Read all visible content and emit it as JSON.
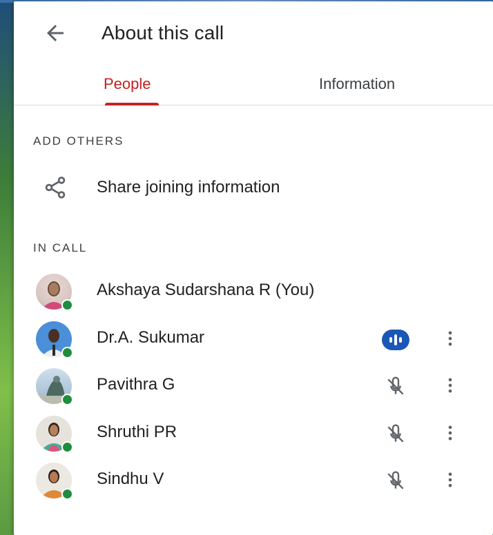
{
  "header": {
    "title": "About this call",
    "back_icon": "arrow-left-icon"
  },
  "tabs": [
    {
      "label": "People",
      "active": true
    },
    {
      "label": "Information",
      "active": false
    }
  ],
  "add_others": {
    "section_label": "ADD OTHERS",
    "share_label": "Share joining information",
    "share_icon": "share-icon"
  },
  "in_call": {
    "section_label": "IN CALL",
    "people": [
      {
        "name": "Akshaya Sudarshana R (You)",
        "status": "none",
        "online": true
      },
      {
        "name": "Dr.A. Sukumar",
        "status": "speaking",
        "online": true
      },
      {
        "name": "Pavithra G",
        "status": "muted",
        "online": true
      },
      {
        "name": "Shruthi PR",
        "status": "muted",
        "online": true
      },
      {
        "name": "Sindhu V",
        "status": "muted",
        "online": true
      }
    ]
  },
  "colors": {
    "accent": "#c5221f",
    "online": "#1e8e3e",
    "speaking": "#1a57b6",
    "text": "#202124",
    "muted_icon": "#5f6368"
  }
}
